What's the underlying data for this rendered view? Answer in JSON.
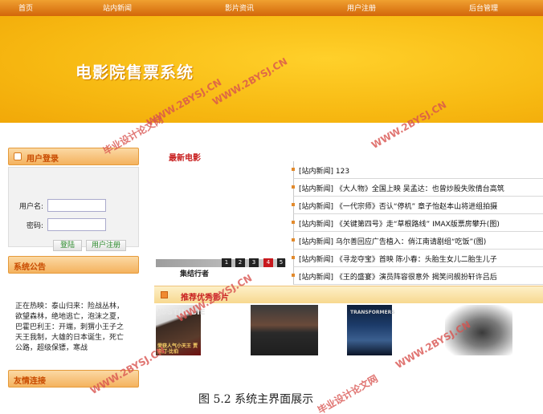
{
  "nav": {
    "items": [
      "首页",
      "站内新闻",
      "影片资讯",
      "用户注册",
      "后台管理"
    ]
  },
  "banner": {
    "title": "电影院售票系统"
  },
  "login": {
    "header": "用户登录",
    "username_label": "用户名:",
    "password_label": "密码:",
    "login_button": "登陆",
    "register_button": "用户注册"
  },
  "notice": {
    "header": "系统公告",
    "text": "正在热映：泰山归来：险战丛林，欲望森林，绝地逃亡，泡沫之夏，巴霍巴利王：开端，刺猬小王子之天王我制，大雄的日本诞生，死亡公路，超级保镖，寒战"
  },
  "links": {
    "header": "友情连接"
  },
  "latest": {
    "title": "最新电影",
    "pages": [
      "1",
      "2",
      "3",
      "4",
      "5"
    ],
    "active_page": "4",
    "caption": "集结行者"
  },
  "news": [
    "[站内新闻] 123",
    "[站内新闻] 《大人物》全国上映 吴孟达：也曾炒股失败倩台高筑",
    "[站内新闻] 《一代宗师》否认“停机” 章子怡赵本山将进组拍摄",
    "[站内新闻] 《关键第四号》走“草根路线” IMAX版票房攀升(图)",
    "[站内新闻] 乌尔善回应广告植入：俏江南请剧组“吃饭”(图)",
    "[站内新闻] 《寻龙夺宝》首映 陈小春：头胎生女儿二胎生儿子",
    "[站内新闻] 《王的盛宴》演员阵容很意外 揭笑问舰扮轩许吕后"
  ],
  "recommend": {
    "title": "推荐优秀影片",
    "poster1_top": "JUSTIN BIE",
    "poster1_bottom": "荣获人气小天王 贾斯汀·比伯",
    "poster3_top": "TRANSFORMERS"
  },
  "caption": "图 5.2 系统主界面展示",
  "watermarks": [
    "WWW.2BYSJ.CN",
    "毕业设计论文网"
  ],
  "colors": {
    "nav": "#e07a18",
    "banner": "#f7b912",
    "accent_red": "#c82020",
    "watermark": "#d9534f"
  }
}
